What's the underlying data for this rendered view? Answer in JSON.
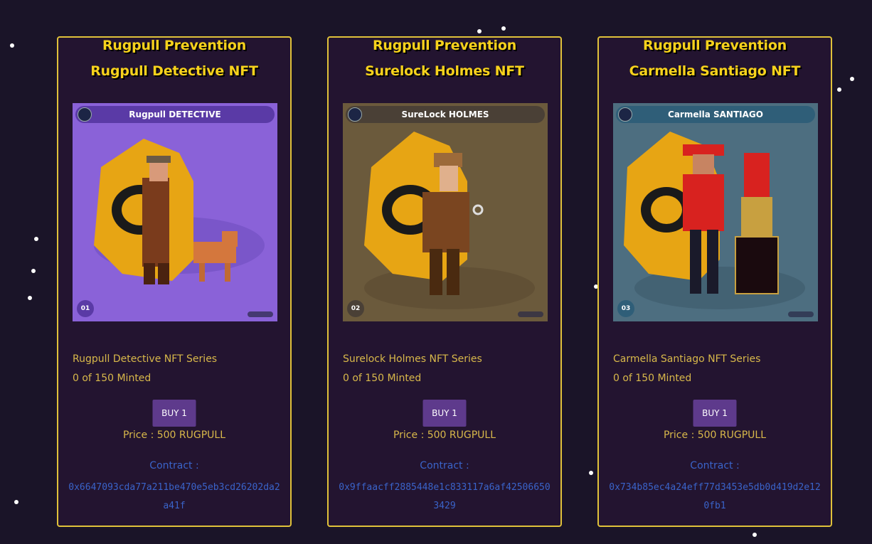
{
  "cards": [
    {
      "title_line1": "Rugpull Prevention",
      "title_line2": "Rugpull Detective NFT",
      "image": {
        "banner_text": "Rugpull DETECTIVE",
        "number": "01",
        "bg_color": "#8a62d8",
        "banner_color": "#5a3aa6",
        "number_color": "#5a3aa6"
      },
      "series": "Rugpull Detective NFT Series",
      "minted": "0 of 150 Minted",
      "buy_label": "BUY 1",
      "price": "Price : 500 RUGPULL",
      "contract_label": "Contract :",
      "contract_address": "0x6647093cda77a211be470e5eb3cd26202da2a41f"
    },
    {
      "title_line1": "Rugpull Prevention",
      "title_line2": "Surelock Holmes NFT",
      "image": {
        "banner_text": "SureLock HOLMES",
        "number": "02",
        "bg_color": "#6b5a3c",
        "banner_color": "#4a4036",
        "number_color": "#4a4036"
      },
      "series": "Surelock Holmes NFT Series",
      "minted": "0 of 150 Minted",
      "buy_label": "BUY 1",
      "price": "Price : 500 RUGPULL",
      "contract_label": "Contract :",
      "contract_address": "0x9ffaacff2885448e1c833117a6af425066503429"
    },
    {
      "title_line1": "Rugpull Prevention",
      "title_line2": "Carmella Santiago NFT",
      "image": {
        "banner_text": "Carmella SANTIAGO",
        "number": "03",
        "bg_color": "#4d6e80",
        "banner_color": "#2f5e78",
        "number_color": "#2f5e78"
      },
      "series": "Carmella Santiago NFT Series",
      "minted": "0 of 150 Minted",
      "buy_label": "BUY 1",
      "price": "Price : 500 RUGPULL",
      "contract_label": "Contract :",
      "contract_address": "0x734b85ec4a24eff77d3453e5db0d419d2e120fb1"
    }
  ]
}
